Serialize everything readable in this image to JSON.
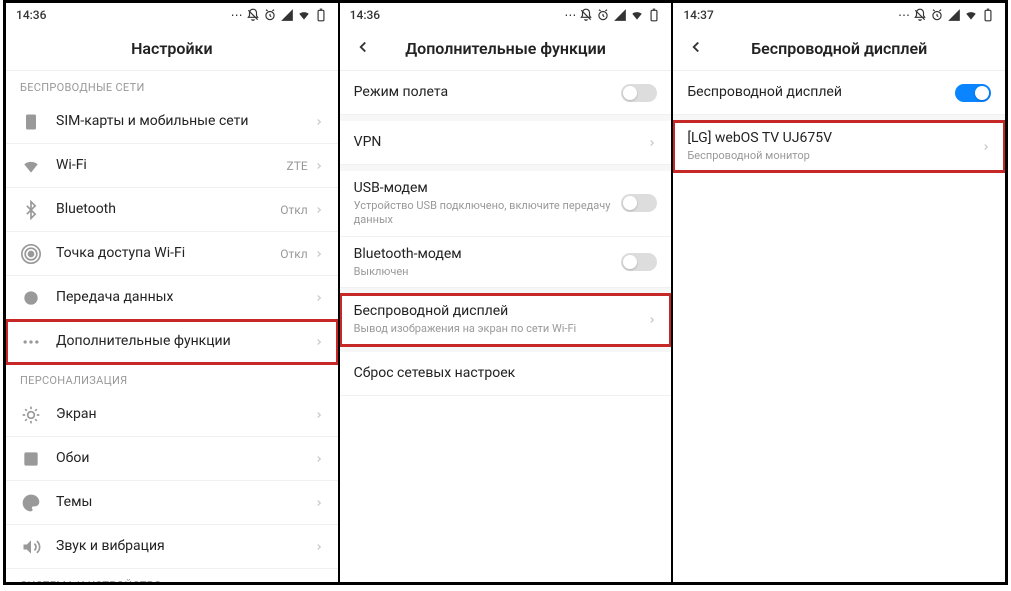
{
  "screen1": {
    "time": "14:36",
    "title": "Настройки",
    "section_wireless": "БЕСПРОВОДНЫЕ СЕТИ",
    "items_wireless": [
      {
        "label": "SIM-карты и мобильные сети",
        "value": ""
      },
      {
        "label": "Wi-Fi",
        "value": "ZTE"
      },
      {
        "label": "Bluetooth",
        "value": "Откл"
      },
      {
        "label": "Точка доступа Wi-Fi",
        "value": "Откл"
      },
      {
        "label": "Передача данных",
        "value": ""
      },
      {
        "label": "Дополнительные функции",
        "value": ""
      }
    ],
    "section_personal": "ПЕРСОНАЛИЗАЦИЯ",
    "items_personal": [
      {
        "label": "Экран"
      },
      {
        "label": "Обои"
      },
      {
        "label": "Темы"
      },
      {
        "label": "Звук и вибрация"
      }
    ],
    "section_system": "СИСТЕМА И УСТРОЙСТВО"
  },
  "screen2": {
    "time": "14:36",
    "title": "Дополнительные функции",
    "items": [
      {
        "label": "Режим полета",
        "type": "toggle",
        "on": false
      },
      {
        "label": "VPN",
        "type": "link"
      },
      {
        "label": "USB-модем",
        "sub": "Устройство USB подключено, включите передачу данных",
        "type": "toggle",
        "on": false
      },
      {
        "label": "Bluetooth-модем",
        "sub": "Выключен",
        "type": "toggle",
        "on": false
      },
      {
        "label": "Беспроводной дисплей",
        "sub": "Вывод изображения на экран по сети Wi-Fi",
        "type": "link"
      },
      {
        "label": "Сброс сетевых настроек",
        "type": "link"
      }
    ]
  },
  "screen3": {
    "time": "14:37",
    "title": "Беспроводной дисплей",
    "toggle_label": "Беспроводной дисплей",
    "device_label": "[LG] webOS TV UJ675V",
    "device_sub": "Беспроводной монитор"
  }
}
